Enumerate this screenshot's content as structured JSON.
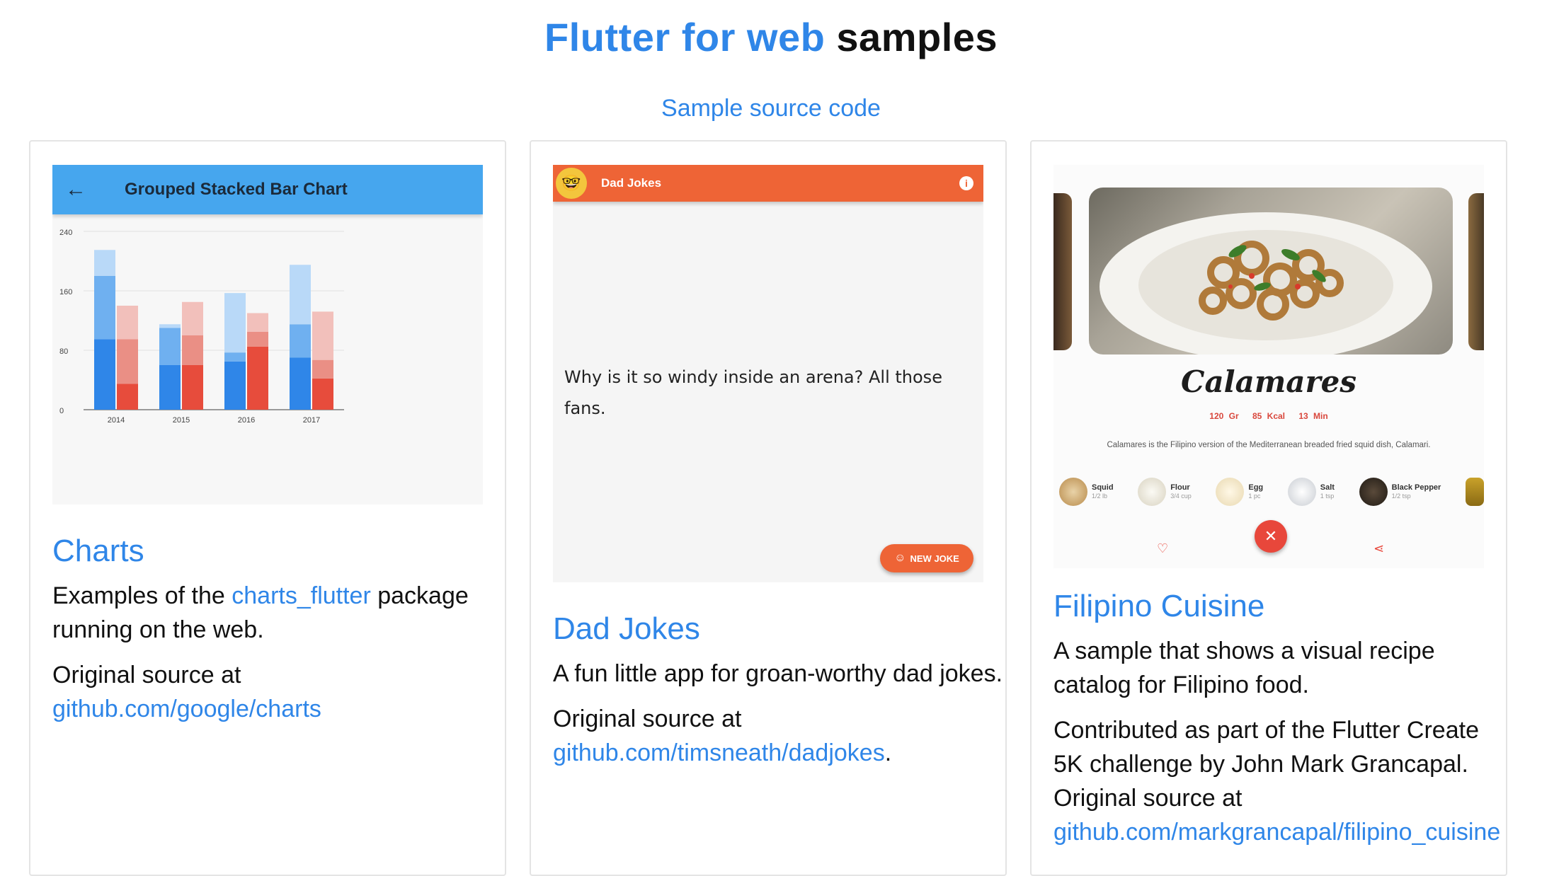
{
  "header": {
    "title_blue": "Flutter for web",
    "title_black": "samples",
    "source_link": "Sample source code"
  },
  "cards": [
    {
      "title": "Charts",
      "desc_prefix": "Examples of the ",
      "desc_link": "charts_flutter",
      "desc_suffix": " package running on the web.",
      "source_prefix": "Original source at",
      "source_link": "github.com/google/charts",
      "source_suffix": "",
      "screenshot": {
        "appbar_title": "Grouped Stacked Bar Chart",
        "back_icon": "arrow-back-icon",
        "appbar_color": "#46a6ee"
      }
    },
    {
      "title": "Dad Jokes",
      "desc": "A fun little app for groan-worthy dad jokes.",
      "source_prefix": "Original source at",
      "source_link": "github.com/timsneath/dadjokes",
      "source_suffix": ".",
      "screenshot": {
        "appbar_title": "Dad Jokes",
        "joke": "Why is it so windy inside an arena? All those fans.",
        "button": "NEW JOKE",
        "appbar_color": "#ee6436"
      }
    },
    {
      "title": "Filipino Cuisine",
      "desc": "A sample that shows a visual recipe catalog for Filipino food.",
      "source_prefix": "Contributed as part of the Flutter Create 5K challenge by John Mark Grancapal. Original source at",
      "source_link": "github.com/markgrancapal/filipino_cuisine",
      "source_suffix": "",
      "screenshot": {
        "dish": "Calamares",
        "weight": "120 Gr",
        "kcal": "85 Kcal",
        "time": "13 Min",
        "description": "Calamares is the Filipino version of the Mediterranean breaded fried squid dish, Calamari.",
        "ingredients": [
          {
            "name": "Squid",
            "qty": "1/2 lb"
          },
          {
            "name": "Flour",
            "qty": "3/4 cup"
          },
          {
            "name": "Egg",
            "qty": "1 pc"
          },
          {
            "name": "Salt",
            "qty": "1 tsp"
          },
          {
            "name": "Black Pepper",
            "qty": "1/2 tsp"
          }
        ]
      }
    }
  ],
  "chart_data": {
    "type": "bar",
    "categories": [
      "2014",
      "2015",
      "2016",
      "2017"
    ],
    "ylim": [
      0,
      240
    ],
    "yticks": [
      0,
      80,
      160,
      240
    ],
    "series": [
      {
        "group": "A",
        "color": "#2f86e8",
        "values": [
          95,
          60,
          65,
          70
        ]
      },
      {
        "group": "A",
        "color": "#6fb0f0",
        "values": [
          85,
          50,
          12,
          45
        ]
      },
      {
        "group": "A",
        "color": "#b9d9f8",
        "values": [
          35,
          5,
          80,
          80
        ]
      },
      {
        "group": "B",
        "color": "#e74c3c",
        "values": [
          35,
          60,
          85,
          42
        ]
      },
      {
        "group": "B",
        "color": "#ea8f85",
        "values": [
          60,
          40,
          20,
          25
        ]
      },
      {
        "group": "B",
        "color": "#f2c0bb",
        "values": [
          45,
          45,
          25,
          65
        ]
      }
    ]
  }
}
